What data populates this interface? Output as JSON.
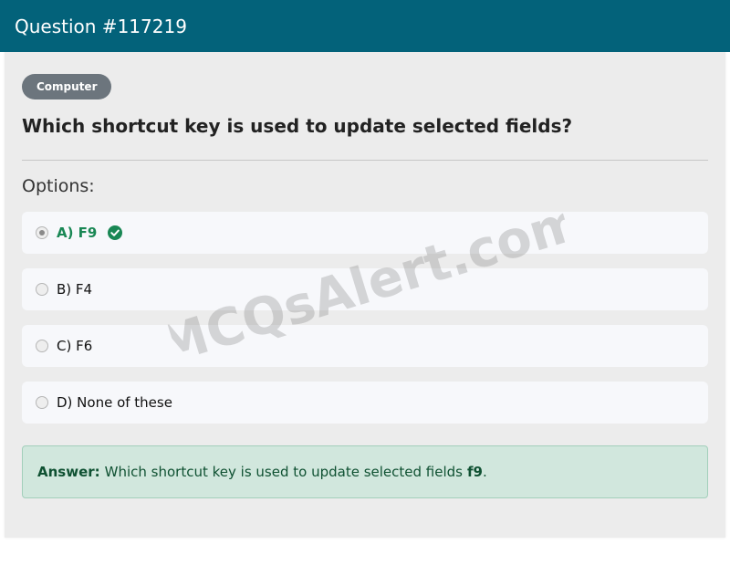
{
  "header": {
    "title": "Question #117219"
  },
  "badge": {
    "label": "Computer"
  },
  "question": {
    "text": "Which shortcut key is used to update selected fields?"
  },
  "options_label": "Options:",
  "options": [
    {
      "text": "A) F9",
      "selected": true,
      "correct": true
    },
    {
      "text": "B) F4",
      "selected": false,
      "correct": false
    },
    {
      "text": "C) F6",
      "selected": false,
      "correct": false
    },
    {
      "text": "D) None of these",
      "selected": false,
      "correct": false
    }
  ],
  "answer": {
    "label": "Answer:",
    "text": "Which shortcut key is used to update selected fields",
    "value": "f9",
    "suffix": "."
  },
  "watermark": {
    "text": "MCQsAlert.com"
  },
  "colors": {
    "header_bg": "#03627a",
    "badge_bg": "#6c757d",
    "correct": "#198754",
    "answer_bg": "#d1e7dd"
  },
  "icons": {
    "correct": "check-circle-icon"
  }
}
